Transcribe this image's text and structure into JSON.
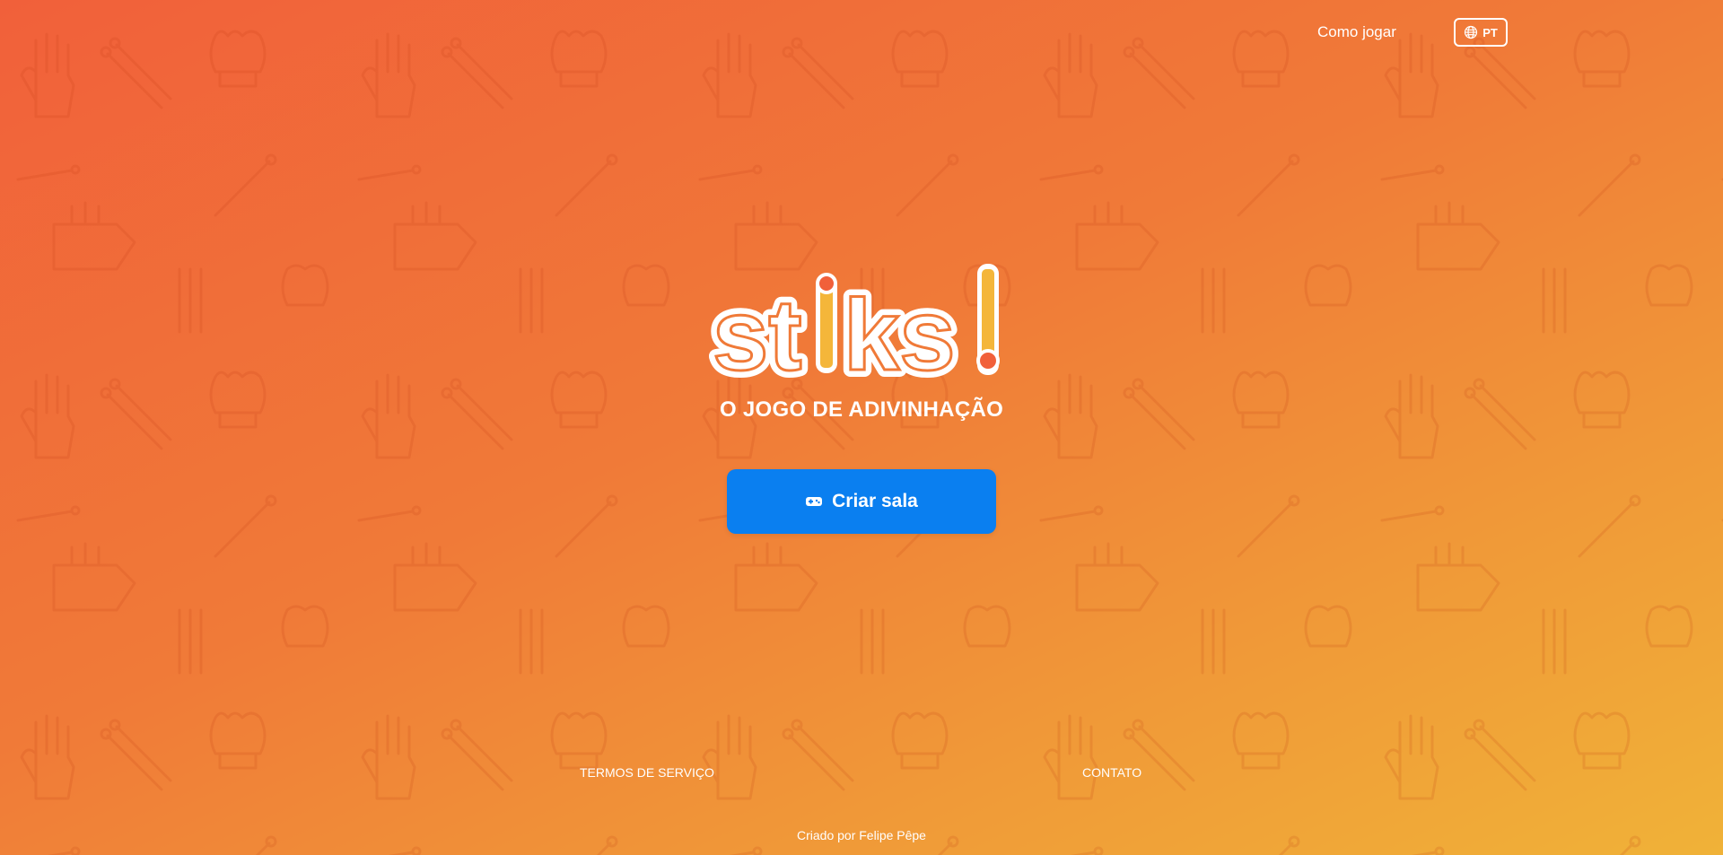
{
  "header": {
    "how_to_play_label": "Como jogar",
    "language_label": "PT",
    "language_icon": "globe-icon"
  },
  "logo": {
    "text": "stiks!",
    "accent_colors": [
      "#f4b63a",
      "#f1603a"
    ]
  },
  "main": {
    "subtitle": "O JOGO DE ADIVINHAÇÃO",
    "create_room_label": "Criar sala",
    "create_room_icon": "gamepad-icon"
  },
  "footer": {
    "terms_label": "TERMOS DE SERVIÇO",
    "contact_label": "CONTATO",
    "credit": "Criado por Felipe Pêpe"
  },
  "colors": {
    "background_start": "#f1603a",
    "background_end": "#f0b238",
    "button": "#0a7ff0",
    "text": "#ffffff"
  }
}
